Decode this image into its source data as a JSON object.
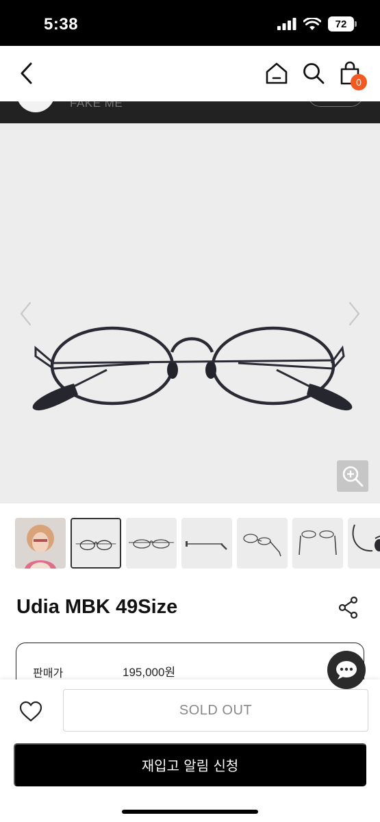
{
  "status_bar": {
    "time": "5:38",
    "battery": "72"
  },
  "nav": {
    "cart_count": "0",
    "icons": [
      "back-arrow-icon",
      "home-icon",
      "search-icon",
      "shopping-bag-icon"
    ]
  },
  "brand": {
    "name": "FAKE ME"
  },
  "gallery": {
    "thumbnail_count": 7,
    "selected_index": 1
  },
  "product": {
    "title": "Udia MBK 49Size",
    "price_label": "판매가",
    "price_value": "195,000원"
  },
  "actions": {
    "sold_out_label": "SOLD OUT",
    "restock_label": "재입고 알림 신청"
  },
  "colors": {
    "badge": "#f05a22",
    "primary_button": "#000000",
    "hero_background": "#ededed"
  }
}
